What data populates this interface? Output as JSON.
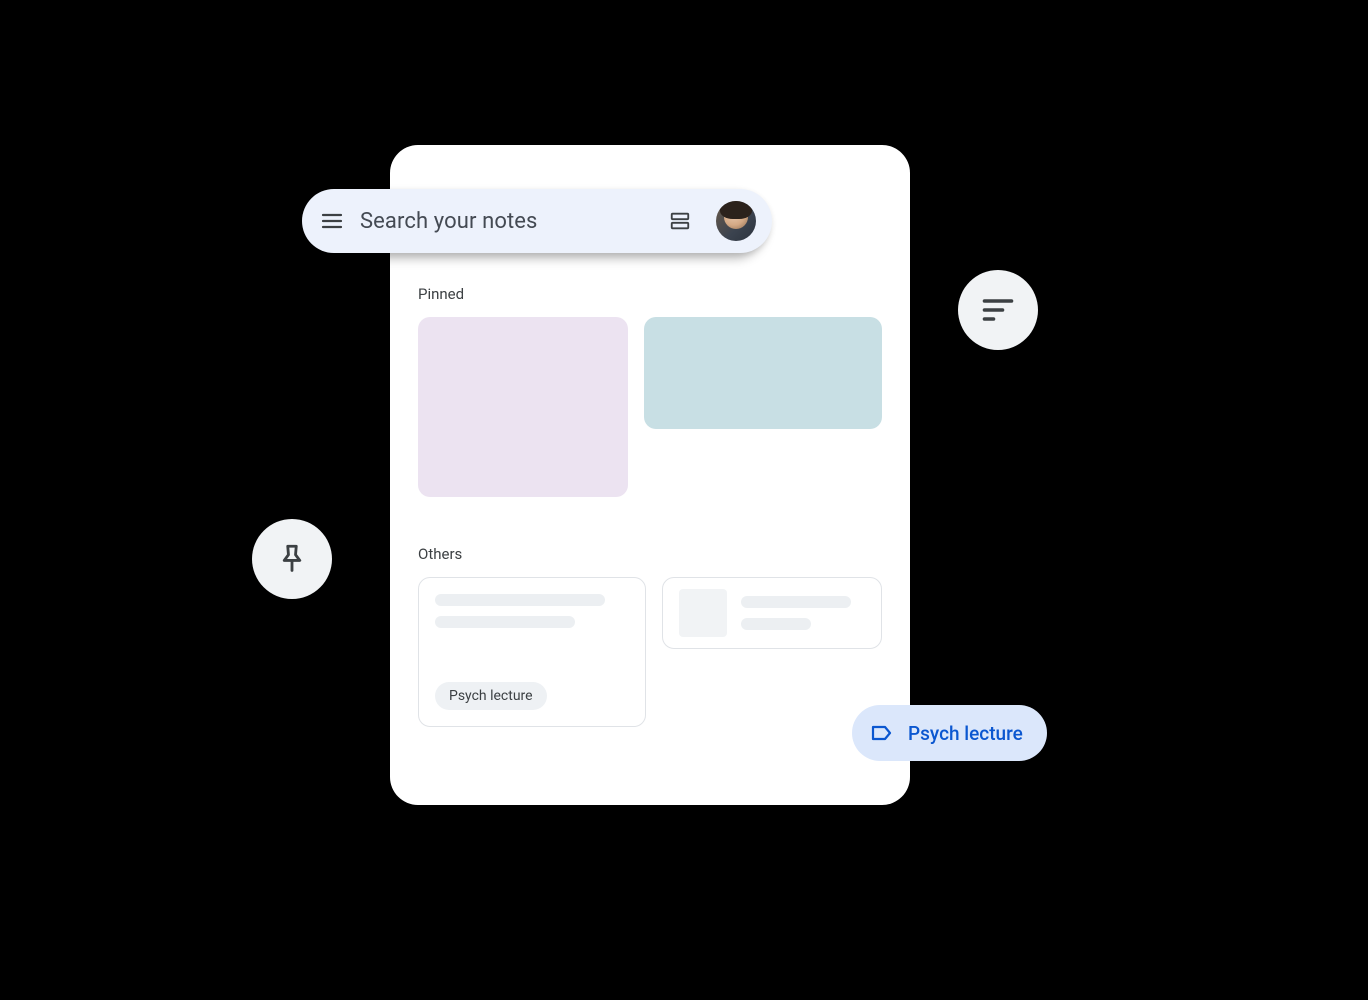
{
  "search": {
    "placeholder": "Search your notes"
  },
  "sections": {
    "pinned": {
      "title": "Pinned"
    },
    "others": {
      "title": "Others"
    }
  },
  "notes": {
    "other_a_chip": "Psych lecture"
  },
  "floating_label": {
    "text": "Psych lecture"
  },
  "colors": {
    "searchbar_bg": "#edf2fc",
    "tile_purple": "#ece3f1",
    "tile_teal": "#c8dfe4",
    "pill_bg": "#dbe7fb",
    "pill_text": "#0b57d0"
  }
}
